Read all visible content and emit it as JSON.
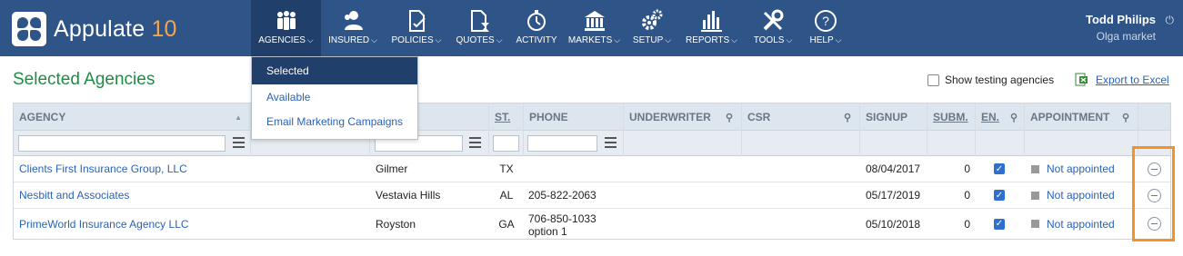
{
  "app": {
    "name": "Appulate",
    "version": "10"
  },
  "nav": [
    {
      "label": "AGENCIES",
      "icon": "agencies-icon",
      "active": true
    },
    {
      "label": "INSURED",
      "icon": "insured-icon"
    },
    {
      "label": "POLICIES",
      "icon": "policies-icon"
    },
    {
      "label": "QUOTES",
      "icon": "quotes-icon"
    },
    {
      "label": "ACTIVITY",
      "icon": "activity-icon"
    },
    {
      "label": "MARKETS",
      "icon": "markets-icon"
    },
    {
      "label": "SETUP",
      "icon": "setup-icon"
    },
    {
      "label": "REPORTS",
      "icon": "reports-icon"
    },
    {
      "label": "TOOLS",
      "icon": "tools-icon"
    },
    {
      "label": "HELP",
      "icon": "help-icon"
    }
  ],
  "user": {
    "name": "Todd Philips",
    "market": "Olga market"
  },
  "page": {
    "title": "Selected Agencies",
    "show_testing_label": "Show testing agencies",
    "export_label": "Export to Excel"
  },
  "dropdown": {
    "items": [
      "Selected",
      "Available",
      "Email Marketing Campaigns"
    ]
  },
  "table": {
    "headers": {
      "agency": "AGENCY",
      "state": "ST.",
      "phone": "PHONE",
      "underwriter": "UNDERWRITER",
      "csr": "CSR",
      "signup": "SIGNUP",
      "subm": "SUBM.",
      "en": "EN.",
      "appointment": "APPOINTMENT"
    },
    "rows": [
      {
        "agency": "Clients First Insurance Group, LLC",
        "city": "Gilmer",
        "state": "TX",
        "phone": "",
        "phone2": "",
        "signup": "08/04/2017",
        "subm": "0",
        "appointment": "Not appointed"
      },
      {
        "agency": "Nesbitt and Associates",
        "city": "Vestavia Hills",
        "state": "AL",
        "phone": "205-822-2063",
        "phone2": "",
        "signup": "05/17/2019",
        "subm": "0",
        "appointment": "Not appointed"
      },
      {
        "agency": "PrimeWorld Insurance Agency LLC",
        "city": "Royston",
        "state": "GA",
        "phone": "706-850-1033",
        "phone2": "option 1",
        "signup": "05/10/2018",
        "subm": "0",
        "appointment": "Not appointed"
      }
    ]
  },
  "colors": {
    "brand": "#2f5588",
    "title_green": "#1f8c44",
    "link": "#2a62b8",
    "highlight": "#f29423"
  }
}
